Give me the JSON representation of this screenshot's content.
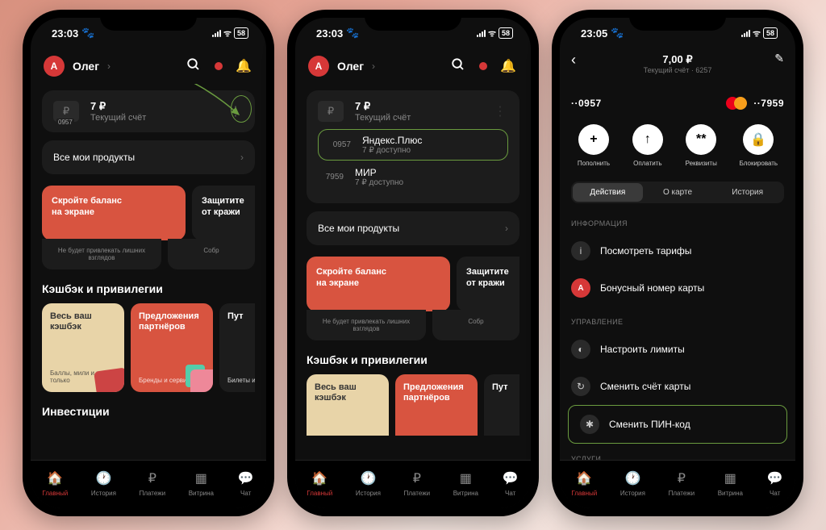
{
  "status": {
    "time1": "23:03",
    "time2": "23:03",
    "time3": "23:05",
    "paw": "🐾",
    "battery": "58"
  },
  "header": {
    "avatar_letter": "А",
    "user_name": "Олег"
  },
  "account": {
    "icon": "₽",
    "badge": "0957",
    "balance": "7 ₽",
    "subtitle": "Текущий счёт"
  },
  "cards": [
    {
      "num": "0957",
      "name": "Яндекс.Плюс",
      "sub": "7 ₽ доступно"
    },
    {
      "num": "7959",
      "name": "МИР",
      "sub": "7 ₽ доступно"
    }
  ],
  "all_products": "Все мои продукты",
  "promos": {
    "p1": {
      "l1": "Скройте баланс",
      "l2": "на экране"
    },
    "p2": {
      "l1": "Защитите",
      "l2": "от кражи"
    },
    "foot1": "Не будет привлекать лишних взглядов",
    "foot2": "Собр"
  },
  "cashback_h": "Кэшбэк и привилегии",
  "tiles": [
    {
      "t1": "Весь ваш",
      "t2": "кэшбэк",
      "s": "Баллы, мили\nи не только"
    },
    {
      "t1": "Предложения",
      "t2": "партнёров",
      "s": "Бренды\nи сервисы"
    },
    {
      "t1": "Пут",
      "t2": "",
      "s": "Билеты\nи отели"
    }
  ],
  "invest_h": "Инвестиции",
  "tabs": [
    {
      "label": "Главный"
    },
    {
      "label": "История"
    },
    {
      "label": "Платежи"
    },
    {
      "label": "Витрина"
    },
    {
      "label": "Чат"
    }
  ],
  "detail": {
    "balance": "7,00 ₽",
    "subtitle": "Текущий счёт · 6257",
    "card_left": "··0957",
    "card_right": "··7959",
    "actions": [
      {
        "icon": "+",
        "label": "Пополнить"
      },
      {
        "icon": "↑",
        "label": "Оплатить"
      },
      {
        "icon": "**",
        "label": "Реквизиты"
      },
      {
        "icon": "lock",
        "label": "Блокировать"
      }
    ],
    "segments": [
      "Действия",
      "О карте",
      "История"
    ],
    "groups": [
      {
        "h": "Информация",
        "items": [
          {
            "icon": "i",
            "label": "Посмотреть тарифы"
          },
          {
            "icon": "A",
            "label": "Бонусный номер карты",
            "red": true
          }
        ]
      },
      {
        "h": "Управление",
        "items": [
          {
            "icon": "◐",
            "label": "Настроить лимиты"
          },
          {
            "icon": "↻",
            "label": "Сменить счёт карты"
          },
          {
            "icon": "✱",
            "label": "Сменить ПИН-код",
            "highlight": true
          }
        ]
      },
      {
        "h": "Услуги",
        "items": []
      }
    ]
  }
}
